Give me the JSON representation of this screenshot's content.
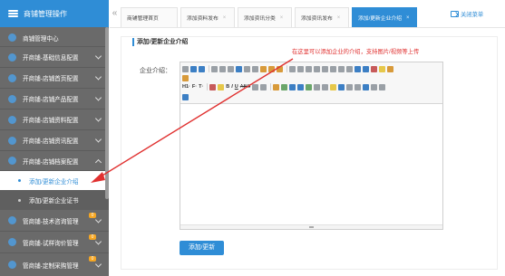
{
  "sidebar": {
    "header_title": "商铺管理操作",
    "items": [
      {
        "label": "商铺管理中心",
        "expandable": false
      },
      {
        "label": "开商铺-基础信息配置",
        "expandable": true
      },
      {
        "label": "开商铺-店铺首页配置",
        "expandable": true
      },
      {
        "label": "开商铺-店铺产品配置",
        "expandable": true
      },
      {
        "label": "开商铺-店铺资料配置",
        "expandable": true
      },
      {
        "label": "开商铺-店铺资讯配置",
        "expandable": true
      },
      {
        "label": "开商铺-店铺档案配置",
        "expandable": true,
        "expanded": true
      }
    ],
    "subitems": [
      {
        "label": "添加/更新企业介绍",
        "active": true
      },
      {
        "label": "添加/更新企业证书",
        "active": false
      }
    ],
    "bottom_items": [
      {
        "label": "管商铺-技术咨询管理",
        "badge": "0"
      },
      {
        "label": "管商铺-试样询价管理",
        "badge": "0"
      },
      {
        "label": "管商铺-定制采购管理",
        "badge": "0"
      }
    ]
  },
  "tabs": [
    {
      "label": "商铺管理首页",
      "closable": false
    },
    {
      "label": "添加资料发布",
      "closable": true
    },
    {
      "label": "添加资讯分类",
      "closable": true
    },
    {
      "label": "添加资讯发布",
      "closable": true
    },
    {
      "label": "添加/更新企业介绍",
      "closable": true,
      "active": true
    }
  ],
  "tab_close_glyph": "×",
  "collapse_glyph": "«",
  "close_menu_label": "关闭菜单",
  "section_title": "添加/更新企业介绍",
  "form_label": "企业介绍：",
  "annotation": "在这里可以添加企业的介绍，支持图片/视频等上传",
  "toolbar_text": {
    "heading": "H1·",
    "font": "F·",
    "size": "T·",
    "bold": "B",
    "italic": "I",
    "underline": "U",
    "strike": "ABC"
  },
  "submit_label": "添加/更新",
  "colors": {
    "accent": "#2f8dd6",
    "sidebar_bg": "#6a6a6a",
    "annotation": "#e0302f",
    "badge": "#f5a623"
  }
}
